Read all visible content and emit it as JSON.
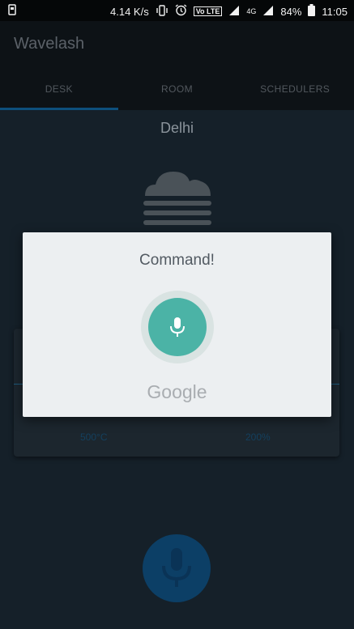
{
  "status_bar": {
    "speed": "4.14 K/s",
    "volte": "Vo LTE",
    "network": "4G",
    "battery": "84%",
    "time": "11:05"
  },
  "app": {
    "title": "Wavelash"
  },
  "tabs": [
    {
      "label": "DESK",
      "active": true
    },
    {
      "label": "ROOM",
      "active": false
    },
    {
      "label": "SCHEDULERS",
      "active": false
    }
  ],
  "weather": {
    "city": "Delhi",
    "icon": "cloud-fog-icon"
  },
  "card": {
    "left_value": "500°C",
    "right_value": "200%"
  },
  "dialog": {
    "title": "Command!",
    "brand": "Google",
    "accent": "#4bb3a6"
  },
  "colors": {
    "background": "#152029",
    "appbar": "#0d1216",
    "tab_indicator": "#0d4f7c",
    "fab": "#0c3f66"
  }
}
